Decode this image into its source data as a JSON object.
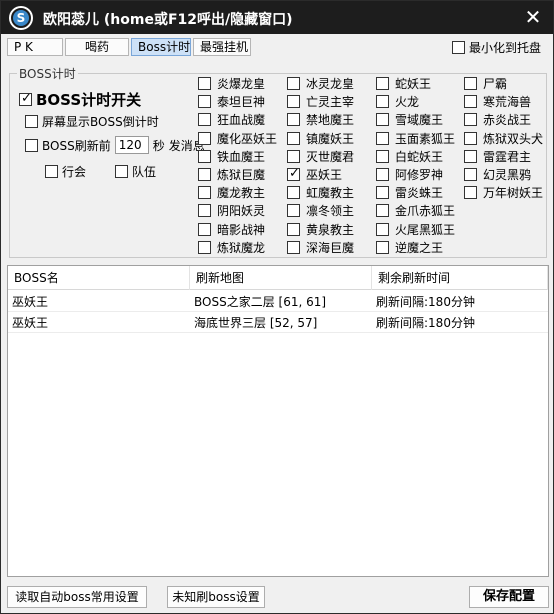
{
  "window": {
    "title": "欧阳蕊儿 (home或F12呼出/隐藏窗口)",
    "icon_letter": "S",
    "close_glyph": "✕"
  },
  "tabs": [
    {
      "label": "P  K",
      "active": false
    },
    {
      "label": "喝药",
      "active": false
    },
    {
      "label": "Boss计时",
      "active": true
    },
    {
      "label": "最强挂机",
      "active": false
    }
  ],
  "minimize_tray": {
    "label": "最小化到托盘",
    "checked": false
  },
  "boss_timer": {
    "group_title": "BOSS计时",
    "switch_label": "BOSS计时开关",
    "switch_checked": true,
    "screen_countdown_label": "屏幕显示BOSS倒计时",
    "screen_countdown_checked": false,
    "refresh_before_label": "BOSS刷新前",
    "refresh_before_value": "120",
    "seconds_label": "秒",
    "send_message_label": "发消息",
    "refresh_before_checked": false,
    "guild_label": "行会",
    "guild_checked": false,
    "team_label": "队伍",
    "team_checked": false
  },
  "bosses": [
    [
      "炎爆龙皇",
      "冰灵龙皇",
      "蛇妖王",
      "尸霸"
    ],
    [
      "泰坦巨神",
      "亡灵主宰",
      "火龙",
      "寒荒海兽"
    ],
    [
      "狂血战魔",
      "禁地魔王",
      "雪域魔王",
      "赤炎战王"
    ],
    [
      "魔化巫妖王",
      "镇魔妖王",
      "玉面素狐王",
      "炼狱双头犬"
    ],
    [
      "铁血魔王",
      "灭世魔君",
      "白蛇妖王",
      "雷霆君主"
    ],
    [
      "炼狱巨魔",
      "巫妖王",
      "阿修罗神",
      "幻灵黑鸦"
    ],
    [
      "魔龙教主",
      "虹魔教主",
      "雷炎蛛王",
      "万年树妖王"
    ],
    [
      "阴阳妖灵",
      "凛冬领主",
      "金爪赤狐王",
      ""
    ],
    [
      "暗影战神",
      "黄泉教主",
      "火尾黑狐王",
      ""
    ],
    [
      "炼狱魔龙",
      "深海巨魔",
      "逆魔之王",
      ""
    ]
  ],
  "boss_checked": "巫妖王",
  "list": {
    "headers": [
      "BOSS名",
      "刷新地图",
      "剩余刷新时间"
    ],
    "rows": [
      [
        "巫妖王",
        "BOSS之家二层 [61, 61]",
        "刷新间隔:180分钟"
      ],
      [
        "巫妖王",
        "海底世界三层 [52, 57]",
        "刷新间隔:180分钟"
      ]
    ]
  },
  "buttons": {
    "read_auto": "读取自动boss常用设置",
    "unknown_boss": "未知刷boss设置",
    "save": "保存配置"
  }
}
